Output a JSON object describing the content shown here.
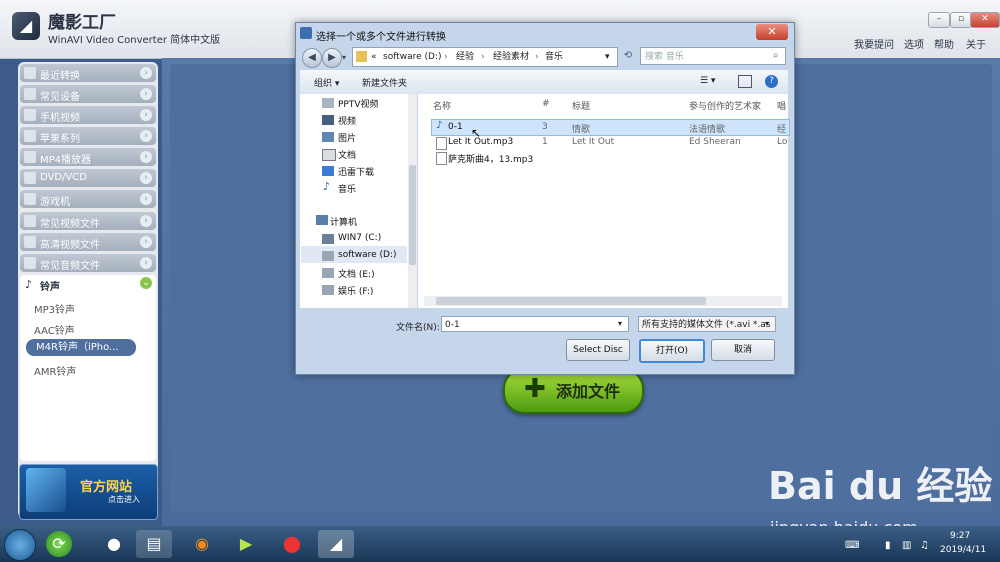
{
  "app": {
    "title": "魔影工厂",
    "subtitle": "WinAVI Video Converter 简体中文版",
    "top_links": [
      "我要提问",
      "选项",
      "帮助",
      "关于"
    ]
  },
  "sidebar": {
    "categories": [
      "最近转换",
      "常见设备",
      "手机视频",
      "苹果系列",
      "MP4播放器",
      "DVD/VCD",
      "游戏机",
      "常见视频文件",
      "高清视频文件",
      "常见音频文件"
    ],
    "ringtone": {
      "label": "铃声",
      "items": [
        "MP3铃声",
        "AAC铃声",
        "M4R铃声（iPho...",
        "AMR铃声"
      ],
      "selected": "M4R铃声（iPho..."
    },
    "promo": {
      "title": "官方网站",
      "subtitle": "点击进入"
    }
  },
  "main": {
    "add_button_label": "添加文件"
  },
  "dialog": {
    "title": "选择一个或多个文件进行转换",
    "close": "✕",
    "address": {
      "prefix": "«",
      "parts": [
        "software (D:)",
        "经验",
        "经验素材",
        "音乐"
      ]
    },
    "search_placeholder": "搜索 音乐",
    "toolbar": {
      "organize": "组织 ▾",
      "new_folder": "新建文件夹"
    },
    "nav": {
      "items": [
        "PPTV视频",
        "视频",
        "图片",
        "文档",
        "迅雷下载",
        "音乐"
      ],
      "computer": "计算机",
      "drives": [
        "WIN7 (C:)",
        "software (D:)",
        "文档 (E:)",
        "娱乐 (F:)"
      ],
      "selected_drive": "software (D:)"
    },
    "columns": [
      "名称",
      "#",
      "标题",
      "参与创作的艺术家",
      "唱"
    ],
    "files": [
      {
        "name": "0-1",
        "num": "3",
        "title": "情歌",
        "artist": "法语情歌",
        "extra": "经"
      },
      {
        "name": "Let It Out.mp3",
        "num": "1",
        "title": "Let It Out",
        "artist": "Ed Sheeran",
        "extra": "Lo"
      },
      {
        "name": "萨克斯曲4，13.mp3",
        "num": "",
        "title": "",
        "artist": "",
        "extra": ""
      }
    ],
    "filename_label": "文件名(N):",
    "filename_value": "0-1",
    "filetype": "所有支持的媒体文件 (*.avi *.as",
    "buttons": {
      "select_disc": "Select Disc",
      "open": "打开(O)",
      "cancel": "取消"
    }
  },
  "taskbar": {
    "time": "9:27",
    "date": "2019/4/11"
  },
  "watermark": {
    "brand": "Bai du 经验",
    "url": "jingyan.baidu.com"
  }
}
